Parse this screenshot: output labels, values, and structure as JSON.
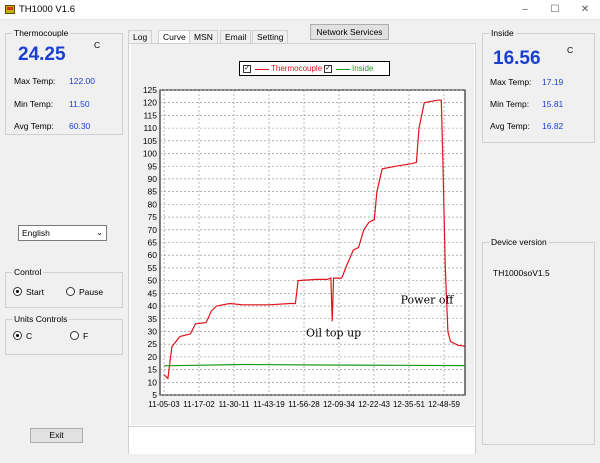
{
  "window": {
    "title": "TH1000 V1.6",
    "controls": [
      "–",
      "☐",
      "✕"
    ]
  },
  "thermocouple": {
    "label": "Thermocouple",
    "value": "24.25",
    "unit": "C",
    "max_label": "Max Temp:",
    "max_value": "122.00",
    "min_label": "Min Temp:",
    "min_value": "11.50",
    "avg_label": "Avg Temp:",
    "avg_value": "60.30"
  },
  "inside": {
    "label": "Inside",
    "value": "16.56",
    "unit": "C",
    "max_label": "Max Temp:",
    "max_value": "17.19",
    "min_label": "Min Temp:",
    "min_value": "15.81",
    "avg_label": "Avg Temp:",
    "avg_value": "16.82"
  },
  "language": {
    "selected": "English"
  },
  "control": {
    "label": "Control",
    "start": "Start",
    "pause": "Pause",
    "selected": "start"
  },
  "units": {
    "label": "Units Controls",
    "c": "C",
    "f": "F",
    "selected": "c"
  },
  "exit_label": "Exit",
  "tabs": [
    {
      "label": "Log",
      "active": false
    },
    {
      "label": "Curve",
      "active": true
    },
    {
      "label": "MSN",
      "active": false
    },
    {
      "label": "Email",
      "active": false
    },
    {
      "label": "Setting",
      "active": false
    }
  ],
  "network_services_label": "Network Services",
  "device": {
    "label": "Device version",
    "value": "TH1000soV1.5"
  },
  "colors": {
    "thermocouple": "#e0141e",
    "inside": "#1a9a1a",
    "value_blue": "#1a3fd0"
  },
  "chart_data": {
    "type": "line",
    "legend_placement": "top",
    "grid": true,
    "ylim": [
      0,
      125
    ],
    "yticks": [
      5,
      10,
      15,
      20,
      25,
      30,
      35,
      40,
      45,
      50,
      55,
      60,
      65,
      70,
      75,
      80,
      85,
      90,
      95,
      100,
      105,
      110,
      115,
      120,
      125
    ],
    "x_ticks": [
      "11-05-03",
      "11-17-02",
      "11-30-11",
      "11-43-19",
      "11-56-28",
      "12-09-34",
      "12-22-43",
      "12-35-51",
      "12-48-59"
    ],
    "series": [
      {
        "name": "Thermocouple",
        "points": [
          [
            0.0,
            13
          ],
          [
            0.15,
            11.5
          ],
          [
            0.3,
            24
          ],
          [
            0.6,
            28
          ],
          [
            1.0,
            29
          ],
          [
            1.2,
            33
          ],
          [
            1.6,
            33.5
          ],
          [
            1.8,
            38
          ],
          [
            2.0,
            40
          ],
          [
            2.5,
            41
          ],
          [
            3.0,
            40.5
          ],
          [
            4.0,
            40.5
          ],
          [
            4.8,
            41
          ],
          [
            5.0,
            41
          ],
          [
            5.1,
            50
          ],
          [
            5.8,
            50.5
          ],
          [
            6.2,
            50.5
          ],
          [
            6.35,
            51
          ],
          [
            6.4,
            34
          ],
          [
            6.45,
            51
          ],
          [
            6.75,
            51
          ],
          [
            6.8,
            52
          ],
          [
            6.95,
            56
          ],
          [
            7.2,
            62
          ],
          [
            7.4,
            63
          ],
          [
            7.6,
            70
          ],
          [
            7.8,
            73
          ],
          [
            8.0,
            74
          ],
          [
            8.1,
            85
          ],
          [
            8.3,
            94
          ],
          [
            8.8,
            95
          ],
          [
            9.4,
            96
          ],
          [
            9.6,
            96.5
          ],
          [
            9.7,
            110
          ],
          [
            9.9,
            120
          ],
          [
            10.4,
            121
          ],
          [
            10.55,
            121
          ],
          [
            10.6,
            100
          ],
          [
            10.7,
            55
          ],
          [
            10.8,
            30
          ],
          [
            10.9,
            26
          ],
          [
            11.2,
            24.5
          ],
          [
            11.45,
            24.25
          ]
        ],
        "annotations": [
          {
            "text": "Oil top up",
            "x": 5.4,
            "y": 28
          },
          {
            "text": "Power off",
            "x": 9.0,
            "y": 41
          }
        ]
      },
      {
        "name": "Inside",
        "points": [
          [
            0.0,
            16.5
          ],
          [
            3.0,
            17
          ],
          [
            6.0,
            16.8
          ],
          [
            9.0,
            16.7
          ],
          [
            11.45,
            16.56
          ]
        ]
      }
    ]
  }
}
